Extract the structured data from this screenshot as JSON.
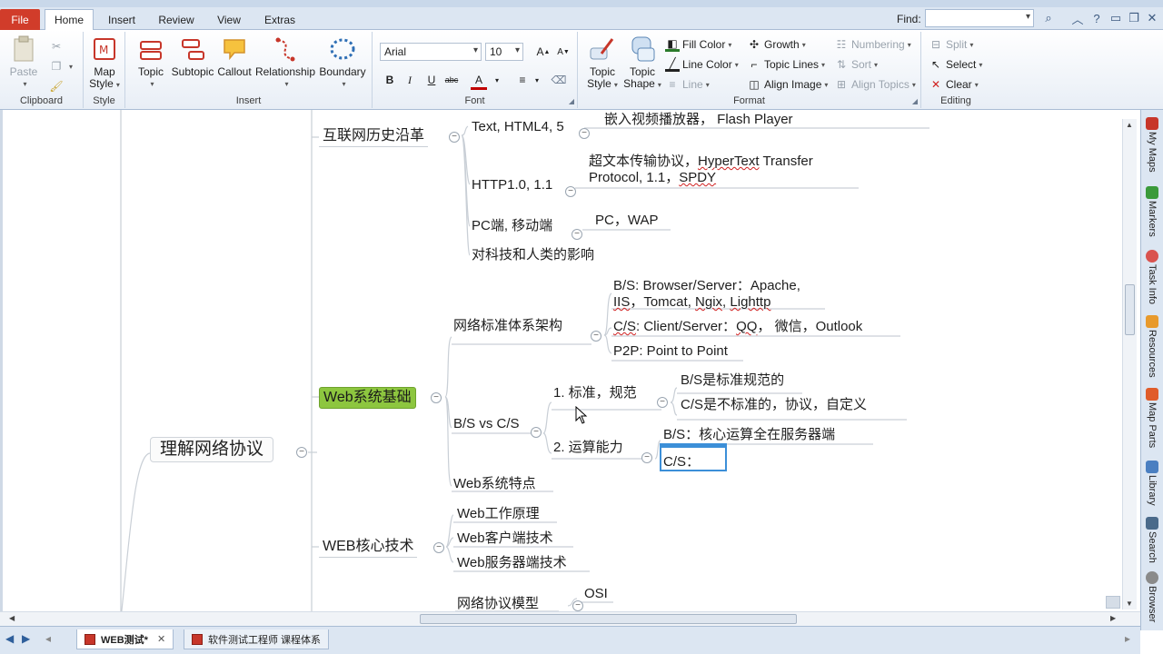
{
  "tabs": {
    "file": "File",
    "home": "Home",
    "insert": "Insert",
    "review": "Review",
    "view": "View",
    "extras": "Extras"
  },
  "find": {
    "label": "Find:"
  },
  "ribbon": {
    "clipboard": {
      "label": "Clipboard",
      "paste": "Paste"
    },
    "style": {
      "label": "Style",
      "map_style_1": "Map",
      "map_style_2": "Style"
    },
    "insert": {
      "label": "Insert",
      "topic": "Topic",
      "subtopic": "Subtopic",
      "callout": "Callout",
      "relationship": "Relationship",
      "boundary": "Boundary"
    },
    "font": {
      "label": "Font",
      "name": "Arial",
      "size": "10"
    },
    "format": {
      "label": "Format",
      "topic_style_1": "Topic",
      "topic_style_2": "Style",
      "topic_shape_1": "Topic",
      "topic_shape_2": "Shape",
      "fill_color": "Fill Color",
      "line_color": "Line Color",
      "line": "Line",
      "growth": "Growth",
      "topic_lines": "Topic Lines",
      "align_image": "Align Image",
      "numbering": "Numbering",
      "sort": "Sort",
      "align_topics": "Align Topics"
    },
    "editing": {
      "label": "Editing",
      "split": "Split",
      "select": "Select",
      "clear": "Clear"
    }
  },
  "map": {
    "central": "理解网络协议",
    "history": {
      "title": "互联网历史沿革",
      "item1": "Text, HTML4, 5",
      "item1_child": "嵌入视频播放器，  Flash Player",
      "item2": "HTTP1.0, 1.1",
      "item2_child_line1_a": "超文本传输协议，",
      "item2_child_line1_b": "HyperText",
      "item2_child_line1_c": " Transfer",
      "item2_child_line2_a": "Protocol, 1.1，",
      "item2_child_line2_b": "SPDY",
      "item3": "PC端, 移动端",
      "item3_child": "PC，WAP",
      "item4": "对科技和人类的影响"
    },
    "web_basics": {
      "title": "Web系统基础",
      "arch": {
        "title": "网络标准体系架构",
        "bs_line1": "B/S: Browser/Server：Apache,",
        "bs_line2_a": "IIS",
        "bs_line2_b": "，Tomcat, ",
        "bs_line2_c": "Ngix",
        "bs_line2_d": ", ",
        "bs_line2_e": "Lighttp",
        "cs_a": "C/S",
        "cs_b": ": Client/Server：",
        "cs_c": "QQ",
        "cs_d": "，  微信，Outlook",
        "p2p": "P2P: Point to Point"
      },
      "bsvscs": {
        "title": "B/S vs C/S",
        "std": "1. 标准，规范",
        "std_bs": "B/S是标准规范的",
        "std_cs": "C/S是不标准的，协议，自定义",
        "compute": "2. 运算能力",
        "compute_bs": "B/S：核心运算全在服务器端",
        "compute_cs": "C/S："
      },
      "features": "Web系统特点"
    },
    "core_tech": {
      "title": "WEB核心技术",
      "item1": "Web工作原理",
      "item2": "Web客户端技术",
      "item3": "Web服务器端技术"
    },
    "protocol_model": {
      "title": "网络协议模型",
      "child": "OSI"
    }
  },
  "side_panel": {
    "my_maps": "My Maps",
    "markers": "Markers",
    "task_info": "Task Info",
    "resources": "Resources",
    "map_parts": "Map Parts",
    "library": "Library",
    "search": "Search",
    "browser": "Browser"
  },
  "doc_tabs": {
    "tab1": "WEB测试*",
    "tab2": "软件测试工程师 课程体系"
  },
  "colors": {
    "file_tab": "#d13c2a",
    "selected_topic": "#8dc63f",
    "ribbon_bg": "#dce6f2",
    "edit_border": "#3c8fd8"
  }
}
